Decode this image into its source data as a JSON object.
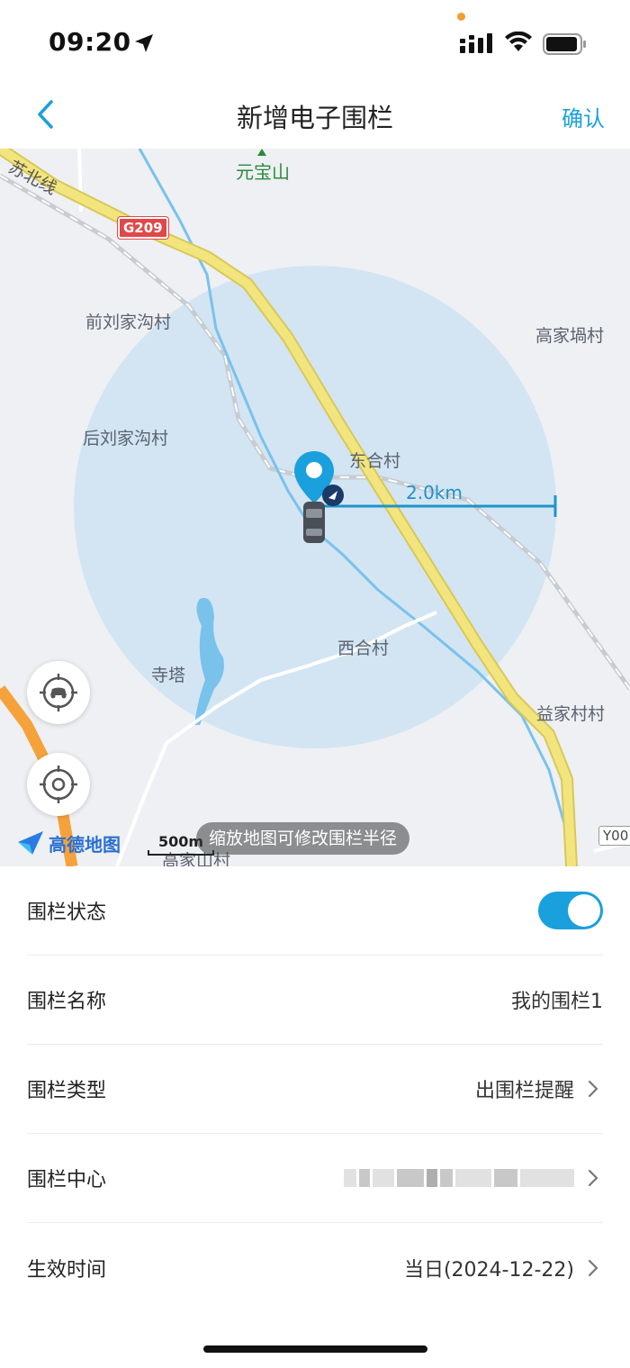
{
  "status_bar": {
    "time": "09:20",
    "icons": [
      "location-arrow-icon",
      "signal-icon",
      "wifi-icon",
      "battery-icon"
    ]
  },
  "nav": {
    "title": "新增电子围栏",
    "confirm_label": "确认",
    "back_icon": "chevron-left-icon"
  },
  "map": {
    "labels": {
      "yuanbaoshan": "元宝山",
      "route": "苏北线",
      "road_g209": "G209",
      "qianliujiagou": "前刘家沟村",
      "gaojiawancun": "高家堝村",
      "houliujiagou": "后刘家沟村",
      "donghecun": "东合村",
      "xihecun": "西合村",
      "sita": "寺塔",
      "yijiacun": "益家村村",
      "gaojiashancun": "高家山村",
      "road_y": "Y00"
    },
    "radius_label": "2.0km",
    "scale_label": "500m",
    "logo_text": "高德地图",
    "zoom_tip": "缩放地图可修改围栏半径",
    "colors": {
      "fence_circle": "#cfe3f2",
      "water": "#79c2ec",
      "main_road": "#f2e27a",
      "accent": "#1aa0dc"
    }
  },
  "settings": {
    "status": {
      "label": "围栏状态",
      "enabled": true
    },
    "name": {
      "label": "围栏名称",
      "value": "我的围栏1"
    },
    "type": {
      "label": "围栏类型",
      "value": "出围栏提醒"
    },
    "center": {
      "label": "围栏中心",
      "value": ""
    },
    "time": {
      "label": "生效时间",
      "value": "当日(2024-12-22)"
    }
  }
}
